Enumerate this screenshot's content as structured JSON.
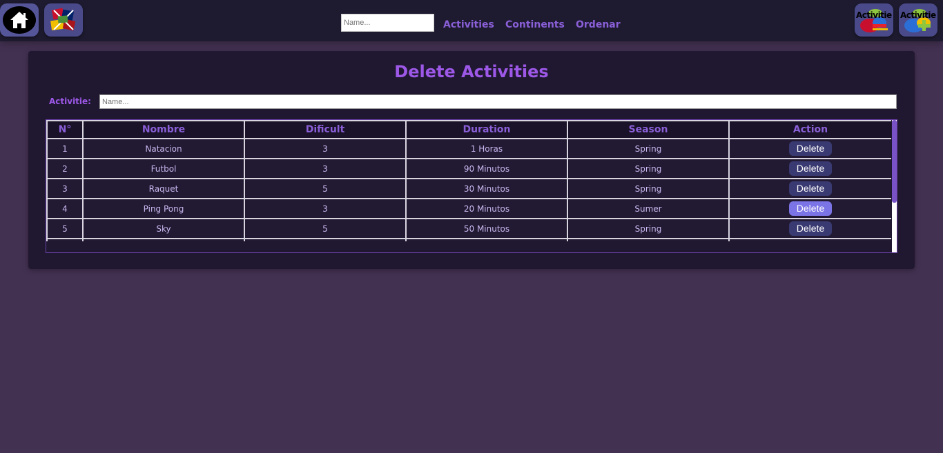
{
  "navbar": {
    "home_icon": "home-icon",
    "flag_icon": "flags-icon",
    "search_placeholder": "Name...",
    "links": [
      "Activities",
      "Continents",
      "Ordenar"
    ],
    "activity_btn_1_text": "Activitie",
    "activity_btn_2_text": "Activitie"
  },
  "panel": {
    "title": "Delete Activities",
    "filter_label": "Activitie:",
    "filter_placeholder": "Name..."
  },
  "table": {
    "headers": [
      "N°",
      "Nombre",
      "Dificult",
      "Duration",
      "Season",
      "Action"
    ],
    "rows": [
      {
        "n": "1",
        "nombre": "Natacion",
        "dificult": "3",
        "duration": "1 Horas",
        "season": "Spring",
        "action": "Delete"
      },
      {
        "n": "2",
        "nombre": "Futbol",
        "dificult": "3",
        "duration": "90 Minutos",
        "season": "Spring",
        "action": "Delete"
      },
      {
        "n": "3",
        "nombre": "Raquet",
        "dificult": "5",
        "duration": "30 Minutos",
        "season": "Spring",
        "action": "Delete"
      },
      {
        "n": "4",
        "nombre": "Ping Pong",
        "dificult": "3",
        "duration": "20 Minutos",
        "season": "Sumer",
        "action": "Delete"
      },
      {
        "n": "5",
        "nombre": "Sky",
        "dificult": "5",
        "duration": "50 Minutos",
        "season": "Spring",
        "action": "Delete"
      }
    ]
  },
  "colors": {
    "accent": "#9d58e8",
    "background": "#433152",
    "navbar": "#1e1b30",
    "button": "#3a3a72",
    "button_hover": "#7b74e6"
  }
}
